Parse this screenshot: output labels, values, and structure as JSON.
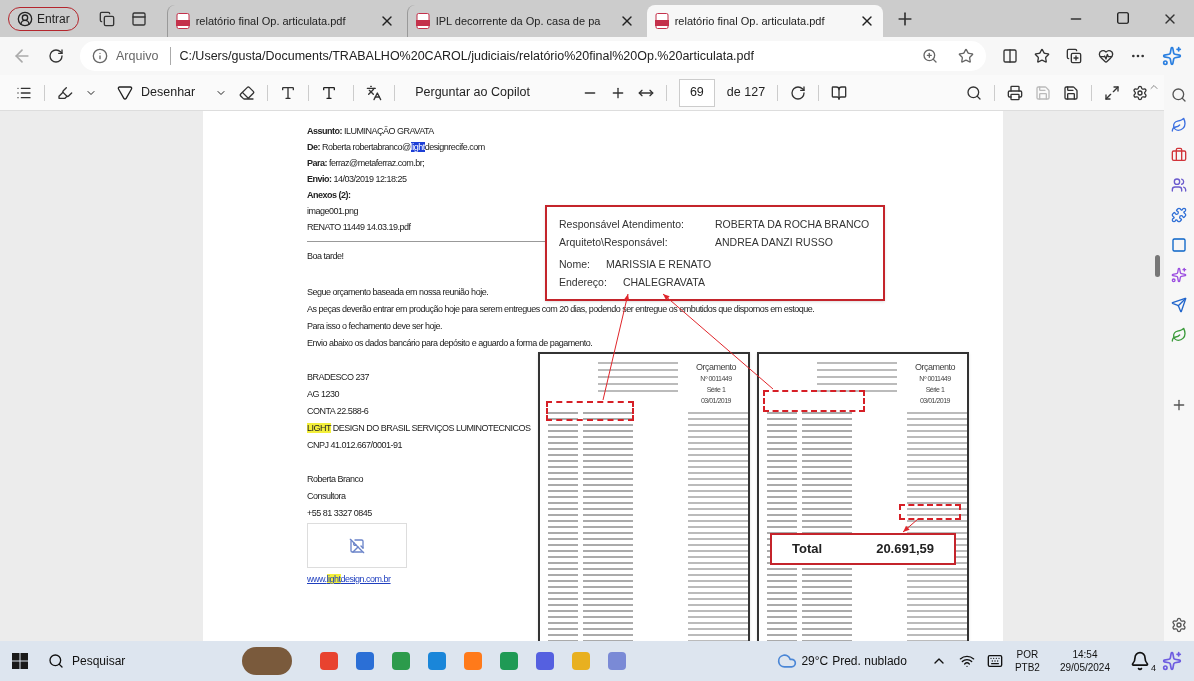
{
  "browser": {
    "profile_button": "Entrar",
    "tabs": [
      {
        "title": "relatório final Op. articulata.pdf",
        "selected": false
      },
      {
        "title": "IPL decorrente da Op. casa de pa",
        "selected": false
      },
      {
        "title": "relatório final Op. articulata.pdf",
        "selected": true
      }
    ],
    "address": {
      "scheme_label": "Arquivo",
      "url": "C:/Users/gusta/Documents/TRABALHO%20CAROL/judiciais/relatório%20final%20Op.%20articulata.pdf"
    }
  },
  "pdf_toolbar": {
    "draw_label": "Desenhar",
    "copilot_label": "Perguntar ao Copilot",
    "page_number": "69",
    "page_total": "de 127"
  },
  "email": {
    "header": [
      [
        {
          "text": "**Assunto:** ILUMINAÇÃO GRAVATA",
          "kind": "plain"
        }
      ],
      [
        {
          "text": "**De:** Roberta robertabranco@",
          "kind": "plain"
        },
        {
          "text": "light",
          "kind": "selected"
        },
        {
          "text": "designrecife.com",
          "kind": "plain"
        }
      ],
      [
        {
          "text": "**Para:** ferraz@metaferraz.com.br;",
          "kind": "plain"
        }
      ],
      [
        {
          "text": "**Envio:** 14/03/2019 12:18:25",
          "kind": "plain"
        }
      ],
      [
        {
          "text": "**Anexos (2):**",
          "kind": "plain"
        }
      ],
      [
        {
          "text": "image001.png",
          "kind": "plain"
        }
      ],
      [
        {
          "text": "RENATO 11449 14.03.19.pdf",
          "kind": "plain"
        }
      ]
    ],
    "greeting": [
      [
        {
          "text": "Boa tarde!",
          "kind": "plain"
        }
      ]
    ],
    "body": [
      [
        {
          "text": "Segue orçamento baseada em nossa reunião hoje.",
          "kind": "plain"
        }
      ],
      [
        {
          "text": "As peças deverão entrar em produção hoje para serem entregues com 20 dias, podendo ser entregue os embutidos que dispomos em estoque.",
          "kind": "plain"
        }
      ],
      [
        {
          "text": "Para isso o fechamento deve ser hoje.",
          "kind": "plain"
        }
      ],
      [
        {
          "text": "Envio abaixo os dados bancário para depósito e aguardo a forma de pagamento.",
          "kind": "plain"
        }
      ]
    ],
    "bank": [
      [
        {
          "text": "BRADESCO 237",
          "kind": "plain"
        }
      ],
      [
        {
          "text": "AG 1230",
          "kind": "plain"
        }
      ],
      [
        {
          "text": "CONTA 22.588-6",
          "kind": "plain"
        }
      ],
      [
        {
          "text": "LIGHT",
          "kind": "highlighted"
        },
        {
          "text": " DESIGN DO BRASIL SERVIÇOS LUMINOTECNICOS",
          "kind": "plain"
        }
      ],
      [
        {
          "text": "CNPJ 41.012.667/0001-91",
          "kind": "plain"
        }
      ]
    ],
    "signature": [
      [
        {
          "text": "Roberta Branco",
          "kind": "plain"
        }
      ],
      [
        {
          "text": "Consultora",
          "kind": "plain"
        }
      ],
      [
        {
          "text": "+55 81 3327 0845",
          "kind": "plain"
        }
      ]
    ],
    "link": [
      {
        "text": "www.",
        "kind": "plain"
      },
      {
        "text": "light",
        "kind": "highlighted"
      },
      {
        "text": "design.com.br",
        "kind": "plain"
      }
    ]
  },
  "callout_client": {
    "rows": [
      {
        "label": "Responsável Atendimento:",
        "value": "ROBERTA DA ROCHA BRANCO"
      },
      {
        "label": "Arquiteto\\Responsável:",
        "value": "ANDREA DANZI RUSSO"
      },
      {
        "label": "Nome:",
        "value": "MARISSIA E RENATO"
      },
      {
        "label": "Endereço:",
        "value": "CHALEGRAVATA"
      }
    ]
  },
  "callout_total": {
    "label": "Total",
    "value": "20.691,59"
  },
  "quotes": [
    {
      "title": "Orçamento",
      "number": "Nº 0011449",
      "series": "Série 1",
      "date": "03/01/2019"
    },
    {
      "title": "Orçamento",
      "number": "Nº 0011449",
      "series": "Série 1",
      "date": "03/01/2019"
    }
  ],
  "taskbar": {
    "search_placeholder": "Pesquisar",
    "temperature": "29°C",
    "weather": "Pred. nublado",
    "language": "POR",
    "layout": "PTB2",
    "time": "14:54",
    "date": "29/05/2024",
    "notifications": "4"
  }
}
